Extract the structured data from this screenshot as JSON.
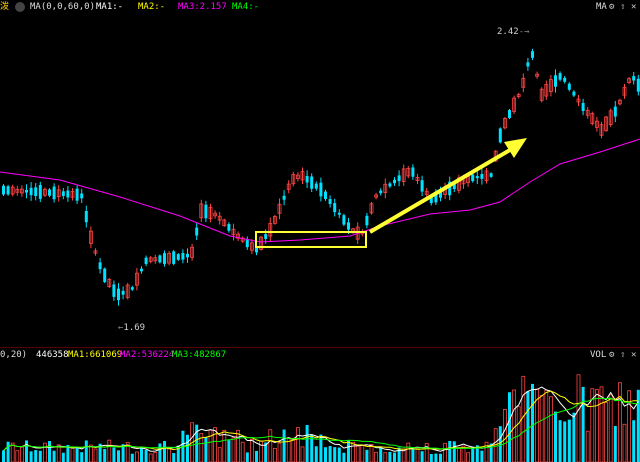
{
  "top": {
    "stock_fragment": "泼",
    "indicator_label": "MA(0,0,60,0)",
    "ma1": "MA1:-",
    "ma2": "MA2:-",
    "ma3": "MA3:2.157",
    "ma4": "MA4:-",
    "right_label": "MA",
    "icons": [
      "dot-menu-icon",
      "gear-icon",
      "up-arrow-icon",
      "close-icon"
    ]
  },
  "volume": {
    "indicator_label": "0,20)",
    "vol_value": "446358",
    "ma1": "MA1:661069",
    "ma2": "MA2:536224",
    "ma3": "MA3:482867",
    "right_label": "VOL",
    "icons": [
      "gear-icon",
      "up-arrow-icon",
      "close-icon"
    ]
  },
  "annotations": {
    "high": "2.42",
    "low": "1.69"
  },
  "colors": {
    "up": "#ff4444",
    "down": "#00e0ff",
    "ma3_line": "#ff00ff",
    "highlight_box": "#ffff33",
    "arrow": "#ffff33",
    "ma1_vol": "#ffffff",
    "ma2_vol": "#ffff00",
    "ma3_vol": "#00ff00"
  }
}
